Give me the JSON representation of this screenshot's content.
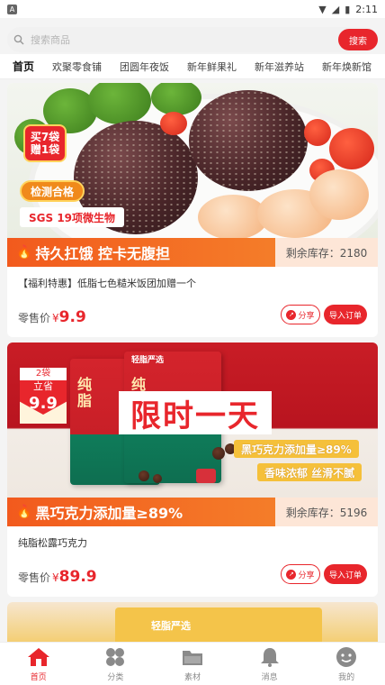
{
  "status_bar": {
    "time": "2:11"
  },
  "search": {
    "placeholder": "搜索商品",
    "button_label": "搜索"
  },
  "categories": [
    "首页",
    "欢聚零食铺",
    "团圆年夜饭",
    "新年鲜果礼",
    "新年滋养站",
    "新年焕新馆"
  ],
  "products": [
    {
      "hero_badges": {
        "buy_line1": "买7袋",
        "buy_line2": "赠1袋",
        "check": "检测合格",
        "sgs": "SGS 19项微生物"
      },
      "slogan": "持久扛饿 控卡无腹担",
      "stock": "剩余库存：2180",
      "title": "【福利特惠】低脂七色糙米饭团加赠一个",
      "price_label": "零售价",
      "currency": "¥",
      "price": "9.9",
      "share_label": "分享",
      "order_label": "导入订单"
    },
    {
      "hero_badges": {
        "tag_top": "2袋",
        "tag_mid": "立省",
        "tag_num": "9.9",
        "limited": "限时一天",
        "bag_brand": "轻脂严选",
        "bag_text": "纯脂",
        "cocoa": "黑巧克力添加量≥89%",
        "taste": "香味浓郁 丝滑不腻"
      },
      "slogan": "黑巧克力添加量≥89%",
      "stock": "剩余库存：5196",
      "title": "纯脂松露巧克力",
      "price_label": "零售价",
      "currency": "¥",
      "price": "89.9",
      "share_label": "分享",
      "order_label": "导入订单"
    },
    {
      "hero_badges": {
        "brand": "轻脂严选"
      }
    }
  ],
  "tabbar": [
    {
      "label": "首页",
      "icon": "home-icon",
      "active": true
    },
    {
      "label": "分类",
      "icon": "category-icon",
      "active": false
    },
    {
      "label": "素材",
      "icon": "folder-icon",
      "active": false
    },
    {
      "label": "消息",
      "icon": "bell-icon",
      "active": false
    },
    {
      "label": "我的",
      "icon": "profile-icon",
      "active": false
    }
  ],
  "colors": {
    "accent": "#e8262c",
    "promo": "#f25a1d",
    "active_tab": "#e8262c"
  }
}
